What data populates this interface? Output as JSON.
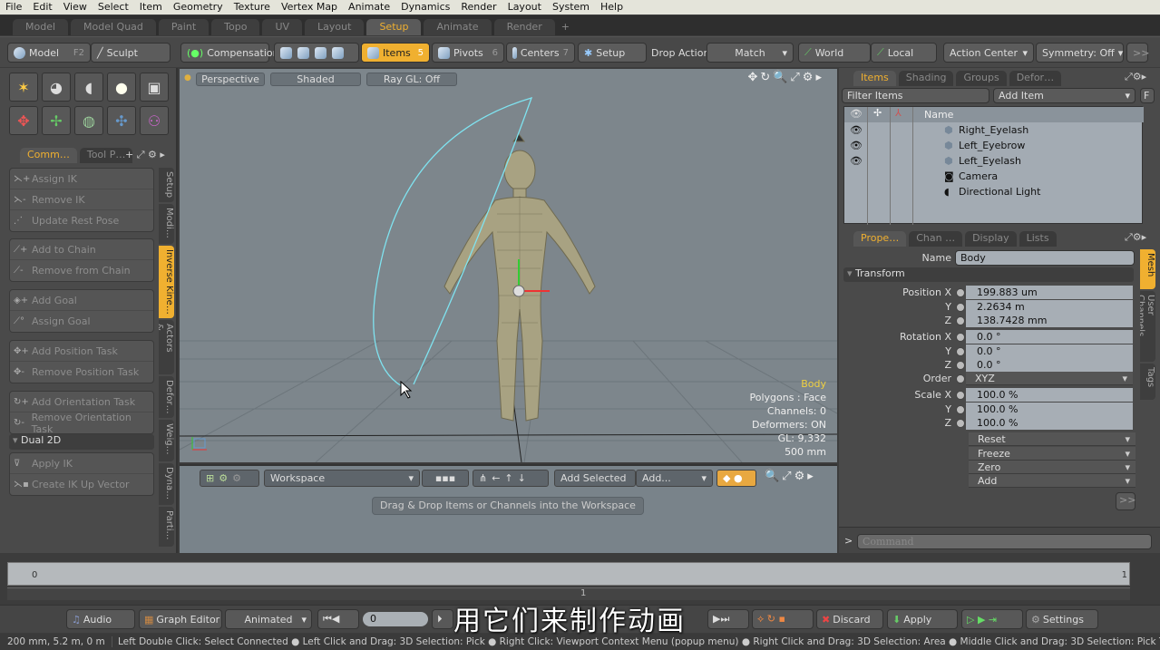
{
  "menu": [
    "File",
    "Edit",
    "View",
    "Select",
    "Item",
    "Geometry",
    "Texture",
    "Vertex Map",
    "Animate",
    "Dynamics",
    "Render",
    "Layout",
    "System",
    "Help"
  ],
  "layout_tabs": [
    "Model",
    "Model Quad",
    "Paint",
    "Topo",
    "UV",
    "Layout",
    "Setup",
    "Animate",
    "Render",
    "+"
  ],
  "toolbar": {
    "model": "Model",
    "model_key": "F2",
    "sculpt": "Sculpt",
    "compensation": "Compensation",
    "items": "Items",
    "items_key": "5",
    "pivots": "Pivots",
    "pivots_key": "6",
    "centers": "Centers",
    "centers_key": "7",
    "setup": "Setup",
    "drop_action": "Drop Action",
    "match": "Match",
    "world": "World",
    "local": "Local",
    "action_center": "Action Center",
    "symmetry": "Symmetry: Off",
    "more": ">>"
  },
  "left_panel": {
    "tabs": [
      "Comm…",
      "Tool P…"
    ],
    "groups": [
      [
        "Assign IK",
        "Remove IK",
        "Update Rest Pose"
      ],
      [
        "Add to Chain",
        "Remove from Chain"
      ],
      [
        "Add Goal",
        "Assign Goal"
      ],
      [
        "Add Position Task",
        "Remove Position Task"
      ],
      [
        "Add Orientation Task",
        "Remove Orientation Task"
      ]
    ],
    "section": "Dual 2D",
    "group2": [
      "Apply IK",
      "Create IK Up Vector"
    ],
    "vtabs": [
      "Setup",
      "Modi…",
      "Inverse Kine…",
      "Actors &…",
      "Defor…",
      "Weig…",
      "Dyna…",
      "Parti…"
    ]
  },
  "viewport": {
    "view": "Perspective",
    "shading": "Shaded",
    "raygl": "Ray GL: Off",
    "info": {
      "item": "Body",
      "polygons": "Polygons : Face",
      "channels": "Channels: 0",
      "deformers": "Deformers: ON",
      "gl": "GL: 9,332",
      "scale": "500 mm"
    },
    "curve_color": "#7fe3f0"
  },
  "workspace": {
    "select": "Workspace",
    "add_selected": "Add Selected",
    "add": "Add...",
    "hint": "Drag & Drop Items or Channels into the Workspace"
  },
  "items_panel": {
    "tabs": [
      "Items",
      "Shading",
      "Groups",
      "Defor…"
    ],
    "filter": "Filter Items",
    "add_item": "Add Item",
    "f": "F",
    "col_name": "Name",
    "rows": [
      {
        "name": "Right_Eyelash",
        "visible": true,
        "icon": "mesh"
      },
      {
        "name": "Left_Eyebrow",
        "visible": true,
        "icon": "mesh"
      },
      {
        "name": "Left_Eyelash",
        "visible": true,
        "icon": "mesh"
      },
      {
        "name": "Camera",
        "visible": false,
        "icon": "camera"
      },
      {
        "name": "Directional Light",
        "visible": false,
        "icon": "light"
      }
    ]
  },
  "properties": {
    "tabs": [
      "Prope…",
      "Chan …",
      "Display",
      "Lists"
    ],
    "name_label": "Name",
    "name": "Body",
    "section": "Transform",
    "rows": [
      {
        "label": "Position X",
        "value": "199.883 um"
      },
      {
        "label": "Y",
        "value": "2.2634 m"
      },
      {
        "label": "Z",
        "value": "138.7428 mm"
      },
      {
        "label": "Rotation X",
        "value": "0.0 °"
      },
      {
        "label": "Y",
        "value": "0.0 °"
      },
      {
        "label": "Z",
        "value": "0.0 °"
      }
    ],
    "order_label": "Order",
    "order": "XYZ",
    "scale": [
      {
        "label": "Scale X",
        "value": "100.0 %"
      },
      {
        "label": "Y",
        "value": "100.0 %"
      },
      {
        "label": "Z",
        "value": "100.0 %"
      }
    ],
    "actions": [
      "Reset",
      "Freeze",
      "Zero",
      "Add"
    ],
    "more": ">>",
    "vtabs": [
      "Mesh",
      "User Channels",
      "Tags"
    ],
    "command_prompt": ">",
    "command_placeholder": "Command"
  },
  "timeline": {
    "start": "0",
    "end": "1",
    "mid": "1"
  },
  "transport": {
    "audio": "Audio",
    "graph_editor": "Graph Editor",
    "mode": "Animated",
    "frame": "0",
    "discard": "Discard",
    "apply": "Apply",
    "settings": "Settings"
  },
  "status": {
    "coords": "200 mm, 5.2 m, 0 m",
    "hints": "Left Double Click: Select Connected ● Left Click and Drag: 3D Selection: Pick ● Right Click: Viewport Context Menu (popup menu) ● Right Click and Drag: 3D Selection: Area ● Middle Click and Drag: 3D Selection: Pick Through"
  },
  "subtitle": "用它们来制作动画",
  "accent": "#f0b030"
}
